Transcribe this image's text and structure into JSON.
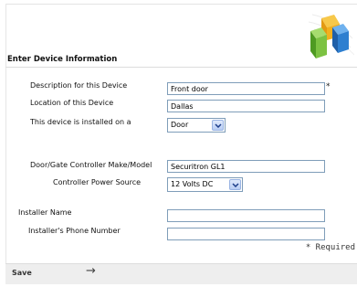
{
  "section_title": "Enter Device Information",
  "fields": {
    "description": {
      "label": "Description for this Device",
      "value": "Front door",
      "required_marker": "*"
    },
    "location": {
      "label": "Location of this Device",
      "value": "Dallas"
    },
    "installed_on": {
      "label": "This device is installed on a",
      "value": "Door"
    },
    "controller": {
      "label": "Door/Gate Controller Make/Model",
      "value": "Securitron GL1"
    },
    "power_source": {
      "label": "Controller Power Source",
      "value": "12 Volts DC"
    },
    "installer_name": {
      "label": "Installer Name",
      "value": ""
    },
    "installer_phone": {
      "label": "Installer's Phone Number",
      "value": ""
    }
  },
  "required_note": "* Required",
  "footer": {
    "save_label": "Save"
  },
  "icons": {
    "logo": "colored-blocks-logo-icon",
    "next": "right-arrow-icon"
  },
  "colors": {
    "logo_green": "#7cc242",
    "logo_blue": "#2e7fd0",
    "logo_yellow": "#f2b01e",
    "footer_bg": "#eeeeee"
  }
}
